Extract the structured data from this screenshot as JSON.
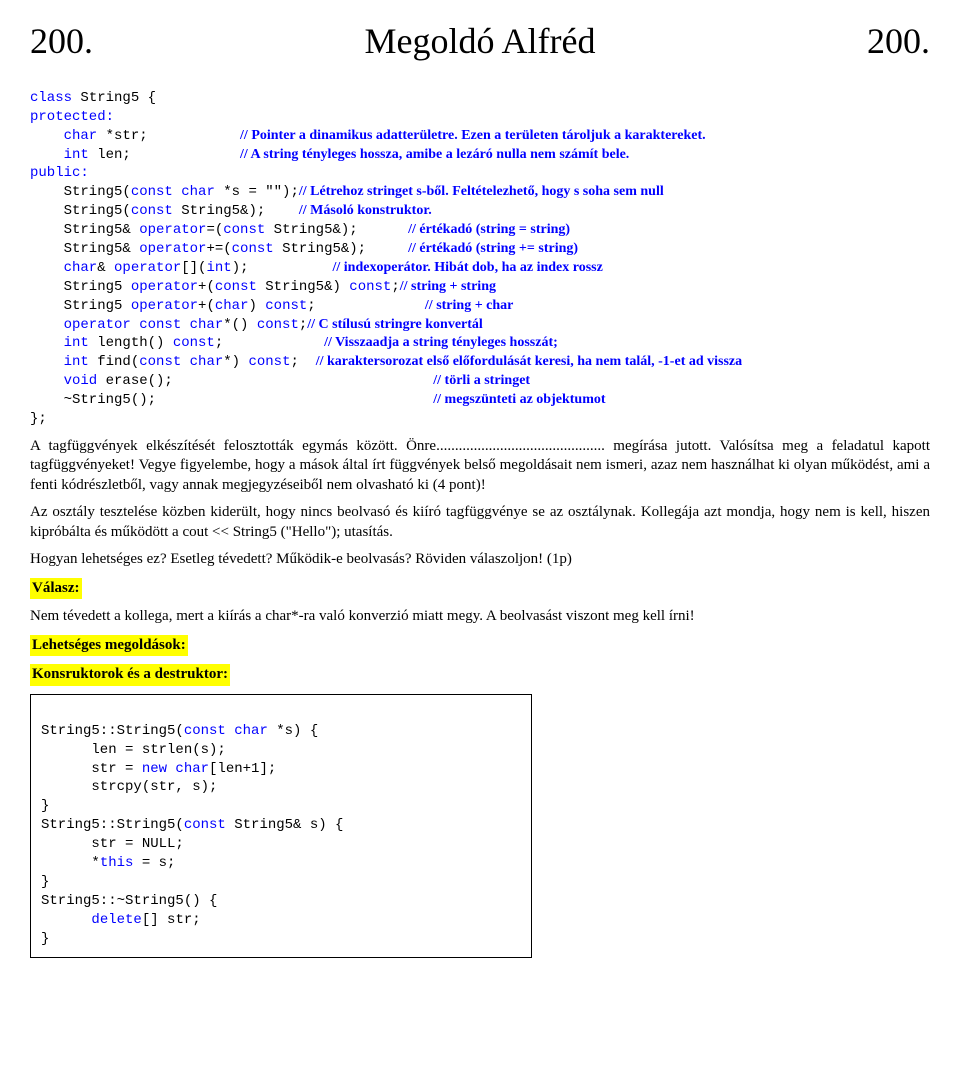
{
  "header": {
    "left": "200.",
    "center": "Megoldó Alfréd",
    "right": "200."
  },
  "class_decl": {
    "l1a": "class",
    "l1b": " String5 {",
    "l2": "protected:",
    "l3a": "    char",
    "l3b": " *str;           ",
    "l3c": "// Pointer a dinamikus adatterületre. Ezen a területen tároljuk a karaktereket.",
    "l4a": "    int",
    "l4b": " len;             ",
    "l4c": "// A string tényleges hossza, amibe a lezáró nulla nem számít bele.",
    "l5": "public:",
    "l6a": "    String5(",
    "l6b": "const char",
    "l6c": " *s = \"\");",
    "l6d": "// Létrehoz stringet s-ből. Feltételezhető, hogy s soha sem null",
    "l7a": "    String5(",
    "l7b": "const",
    "l7c": " String5&);    ",
    "l7d": "// Másoló konstruktor.",
    "l8a": "    String5& ",
    "l8b": "operator",
    "l8c": "=(",
    "l8d": "const",
    "l8e": " String5&);      ",
    "l8f": "// értékadó (string = string)",
    "l9a": "    String5& ",
    "l9b": "operator",
    "l9c": "+=(",
    "l9d": "const",
    "l9e": " String5&);     ",
    "l9f": "// értékadó (string += string)",
    "l10a": "    char",
    "l10b": "& ",
    "l10c": "operator",
    "l10d": "[](",
    "l10e": "int",
    "l10f": ");          ",
    "l10g": "// indexoperátor. Hibát dob, ha az index rossz",
    "l11a": "    String5 ",
    "l11b": "operator",
    "l11c": "+(",
    "l11d": "const",
    "l11e": " String5&) ",
    "l11f": "const",
    "l11g": ";",
    "l11h": "// string + string",
    "l12a": "    String5 ",
    "l12b": "operator",
    "l12c": "+(",
    "l12d": "char",
    "l12e": ") ",
    "l12f": "const",
    "l12g": ";             ",
    "l12h": "// string + char",
    "l13a": "    operator const char",
    "l13b": "*() ",
    "l13c": "const",
    "l13d": ";",
    "l13e": "// C stílusú stringre konvertál",
    "l14a": "    int",
    "l14b": " length() ",
    "l14c": "const",
    "l14d": ";            ",
    "l14e": "// Visszaadja a string tényleges hosszát;",
    "l15a": "    int",
    "l15b": " find(",
    "l15c": "const char",
    "l15d": "*) ",
    "l15e": "const",
    "l15f": ";  ",
    "l15g": "// karaktersorozat első előfordulását keresi, ha nem talál, -1-et ad vissza",
    "l16a": "    void",
    "l16b": " erase();                               ",
    "l16c": "// törli a stringet",
    "l17a": "    ~String5();                                 ",
    "l17b": "// megszünteti az objektumot",
    "l18": "};"
  },
  "para1": "A tagfüggvények elkészítését felosztották egymás között. Önre............................................. megírása jutott. Valósítsa meg a feladatul kapott tagfüggvényeket! Vegye figyelembe, hogy a mások által írt függvények belső megoldásait nem ismeri, azaz nem használhat ki olyan működést, ami a fenti kódrészletből, vagy annak megjegyzéseiből nem olvasható ki (4 pont)!",
  "para2": "Az osztály tesztelése közben kiderült, hogy nincs beolvasó és kiíró tagfüggvénye se az osztálynak. Kollegája azt mondja, hogy nem is kell, hiszen kipróbálta és működött a cout << String5 (\"Hello\"); utasítás.",
  "para3": "Hogyan lehetséges ez? Esetleg tévedett? Működik-e beolvasás? Röviden válaszoljon! (1p)",
  "answer_label": "Válasz:",
  "answer_text": "Nem tévedett a kollega, mert a kiírás a char*-ra való konverzió miatt megy. A beolvasást viszont meg kell írni!",
  "solutions_label": "Lehetséges megoldások:",
  "ctor_label": "Konsruktorok és a destruktor:",
  "sol": {
    "l1a": "String5::String5(",
    "l1b": "const char",
    "l1c": " *s) {",
    "l2": "      len = strlen(s);",
    "l3a": "      str = ",
    "l3b": "new char",
    "l3c": "[len+1];",
    "l4": "      strcpy(str, s);",
    "l5": "}",
    "l6a": "String5::String5(",
    "l6b": "const",
    "l6c": " String5& s) {",
    "l7": "      str = NULL;",
    "l8a": "      *",
    "l8b": "this",
    "l8c": " = s;",
    "l9": "}",
    "l10": "String5::~String5() {",
    "l11a": "      ",
    "l11b": "delete",
    "l11c": "[] str;",
    "l12": "}"
  }
}
